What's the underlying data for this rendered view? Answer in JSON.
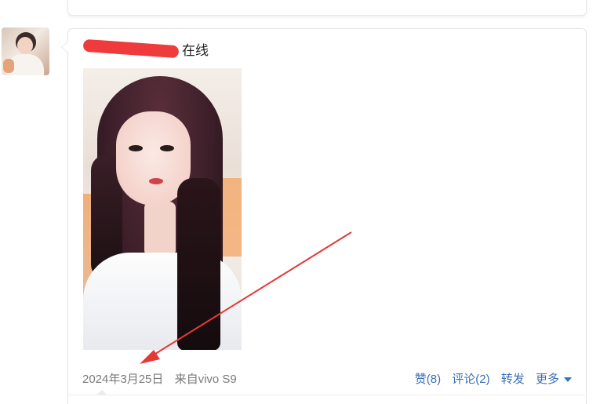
{
  "post": {
    "status": "在线",
    "date": "2024年3月25日",
    "source": "来自vivo S9",
    "actions": {
      "like": "赞(8)",
      "comment": "评论(2)",
      "share": "转发",
      "more": "更多"
    }
  },
  "colors": {
    "link": "#3b6fb6",
    "meta": "#7a7a7a",
    "redaction": "#ef3b3b",
    "annotation_arrow": "#e53935"
  },
  "icons": {
    "more_caret": "caret-down-icon"
  }
}
